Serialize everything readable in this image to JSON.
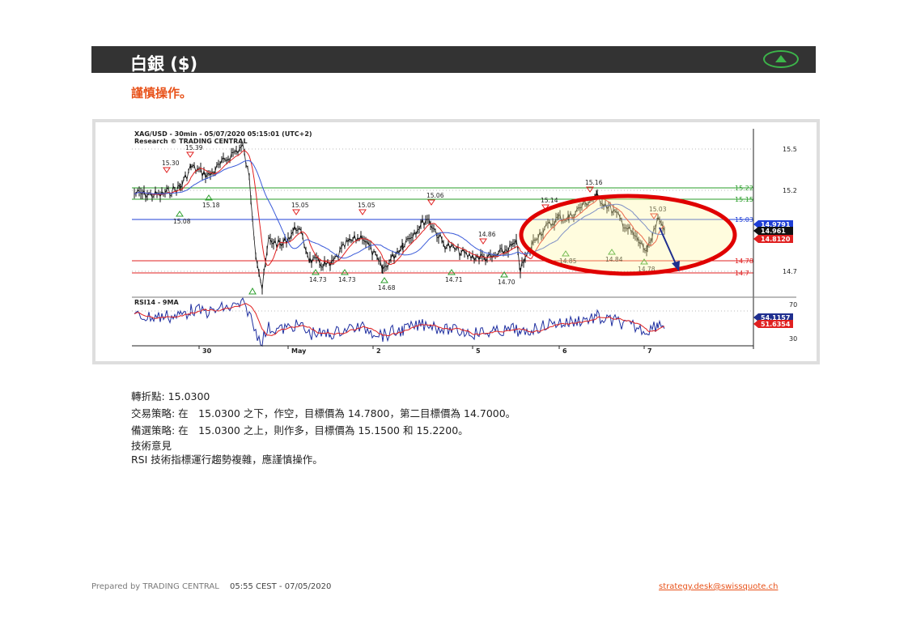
{
  "header": {
    "title": "白銀 ($)",
    "toggle_icon": "triangle-up-icon",
    "toggle_color": "#3cb54a"
  },
  "subtitle": "謹慎操作。",
  "colors": {
    "accent": "#e8531b",
    "header_bg": "#333333",
    "green": "#2a9d2a",
    "blue": "#1f3fd6",
    "red": "#e02020",
    "highlight": "#e00000"
  },
  "chart": {
    "title_line1": "XAG/USD - 30min - 05/07/2020 05:15:01 (UTC+2)",
    "title_line2": "Research © TRADING CENTRAL",
    "rsi_label": "RSI14 - 9MA",
    "price_ticks": [
      "15.5",
      "15.2",
      "14.7"
    ],
    "rsi_ticks": [
      "70",
      "30"
    ],
    "x_ticks": [
      "30",
      "May",
      "2",
      "5",
      "6",
      "7"
    ],
    "level_labels": {
      "r2": "15.22",
      "r1": "15.15",
      "pivot": "15.03",
      "s1": "14.78",
      "s2": "14.7"
    },
    "price_tags": {
      "current": "14.9791",
      "close": "14.961",
      "red": "14.8120"
    },
    "rsi_tags": {
      "rsi": "54.1157",
      "ma": "51.6354"
    },
    "peak_labels": [
      "15.30",
      "15.39",
      "15.05",
      "15.05",
      "15.06",
      "14.86",
      "15.14",
      "15.16",
      "15.03"
    ],
    "trough_labels": [
      "15.08",
      "15.18",
      "14.73",
      "14.73",
      "14.68",
      "14.71",
      "14.70",
      "14.85",
      "14.84",
      "14.78"
    ]
  },
  "analysis": {
    "pivot": "轉折點: 15.0300",
    "strategy": "交易策略: 在　15.0300 之下，作空，目標價為  14.7800，第二目標價為  14.7000。",
    "alternative": "備選策略: 在　15.0300 之上，則作多，目標價為  15.1500 和 15.2200。",
    "opinion_title": "技術意見",
    "opinion_text": "RSI 技術指標運行趨勢複雜，應謹慎操作。"
  },
  "footer": {
    "prepared": "Prepared by TRADING CENTRAL",
    "timestamp": "05:55 CEST - 07/05/2020",
    "email": "strategy.desk@swissquote.ch"
  }
}
